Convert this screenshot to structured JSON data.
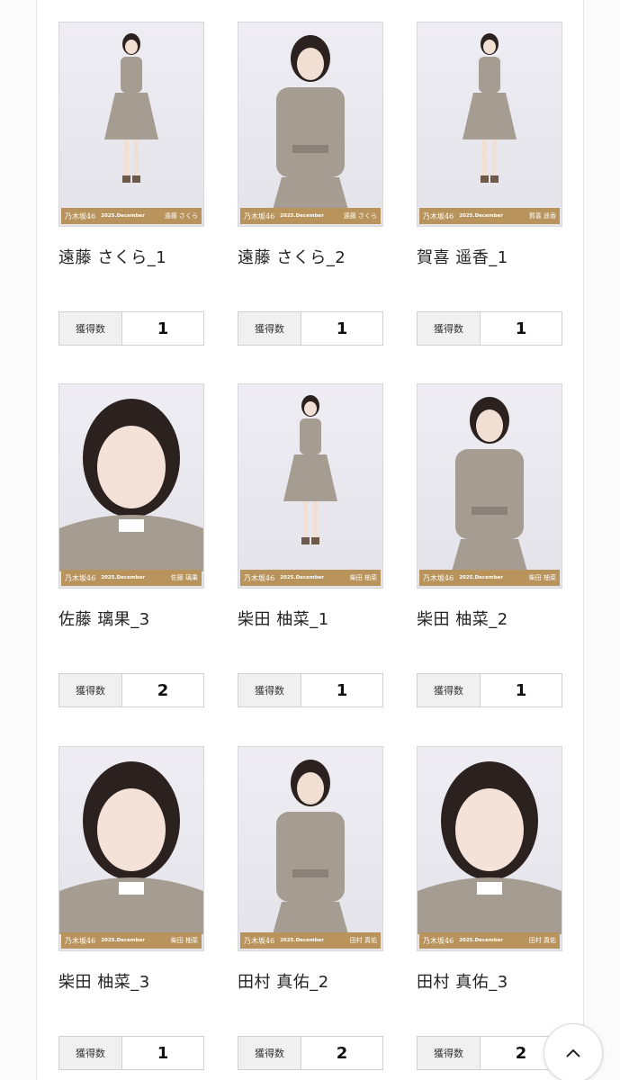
{
  "count_label": "獲得数",
  "strip": {
    "logo": "乃木坂46",
    "edition": "2025.December"
  },
  "cards": [
    {
      "title": "遠藤 さくら_1",
      "strip_name": "遠藤 さくら",
      "count": "1",
      "shot": "full"
    },
    {
      "title": "遠藤 さくら_2",
      "strip_name": "遠藤 さくら",
      "count": "1",
      "shot": "half"
    },
    {
      "title": "賀喜 遥香_1",
      "strip_name": "賀喜 遥香",
      "count": "1",
      "shot": "full"
    },
    {
      "title": "佐藤 璃果_3",
      "strip_name": "佐藤 璃果",
      "count": "2",
      "shot": "close"
    },
    {
      "title": "柴田 柚菜_1",
      "strip_name": "柴田 柚菜",
      "count": "1",
      "shot": "full"
    },
    {
      "title": "柴田 柚菜_2",
      "strip_name": "柴田 柚菜",
      "count": "1",
      "shot": "half"
    },
    {
      "title": "柴田 柚菜_3",
      "strip_name": "柴田 柚菜",
      "count": "1",
      "shot": "close"
    },
    {
      "title": "田村 真佑_2",
      "strip_name": "田村 真佑",
      "count": "2",
      "shot": "half"
    },
    {
      "title": "田村 真佑_3",
      "strip_name": "田村 真佑",
      "count": "2",
      "shot": "close"
    }
  ],
  "back_to_top": {
    "icon": "chevron-up-icon"
  },
  "colors": {
    "strip": "#b8935b",
    "uniform": "#a59c92",
    "hair": "#2b2220",
    "background": "#ffffff"
  }
}
